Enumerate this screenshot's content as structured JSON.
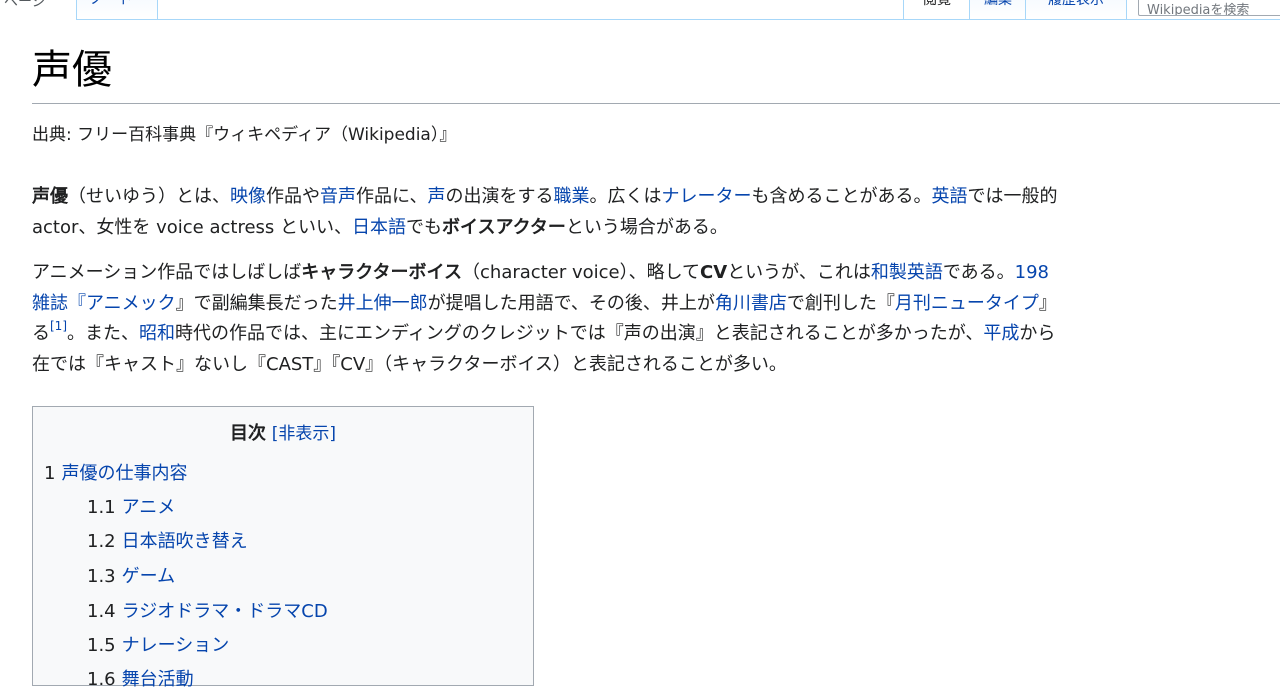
{
  "tabs": {
    "left_cut": "ページ",
    "talk": "ノート",
    "view": "閲覧",
    "edit": "編集",
    "history": "履歴表示",
    "search_placeholder": "Wikipediaを検索"
  },
  "article": {
    "title": "声優",
    "site_sub": "出典: フリー百科事典『ウィキペディア（Wikipedia）』"
  },
  "p1": {
    "s1": "声優",
    "s2": "（せいゆう）とは、",
    "s3": "映像",
    "s4": "作品や",
    "s5": "音声",
    "s6": "作品に、",
    "s7": "声",
    "s8": "の出演をする",
    "s9": "職業",
    "s10": "。広くは",
    "s11": "ナレーター",
    "s12": "も含めることがある。",
    "s13": "英語",
    "s14": "では一般的",
    "s15": "actor、女性を voice actress といい、",
    "s16": "日本語",
    "s17": "でも",
    "s18": "ボイスアクター",
    "s19": "という場合がある。"
  },
  "p2": {
    "a1": "アニメーション作品ではしばしば",
    "a2": "キャラクターボイス",
    "a3": "（character voice）、略して",
    "a4": "CV",
    "a5": "というが、これは",
    "a6": "和製英語",
    "a7": "である。",
    "a8": "198",
    "b1": "雑誌『",
    "b2": "アニメック",
    "b3": "』で副編集長だった",
    "b4": "井上伸一郎",
    "b5": "が提唱した用語で、その後、井上が",
    "b6": "角川書店",
    "b7": "で創刊した『",
    "b8": "月刊ニュータイプ",
    "b9": "』",
    "c1": "る",
    "c2": "[1]",
    "c3": "。また、",
    "c4": "昭和",
    "c5": "時代の作品では、主にエンディングのクレジットでは『声の出演』と表記されることが多かったが、",
    "c6": "平成",
    "c7": "から",
    "d1": "在では『キャスト』ないし『CAST』『CV』（キャラクターボイス）と表記されることが多い。"
  },
  "toc": {
    "title": "目次",
    "toggle": "[非表示]",
    "items": [
      {
        "num": "1",
        "label": "声優の仕事内容"
      },
      {
        "num": "1.1",
        "label": "アニメ"
      },
      {
        "num": "1.2",
        "label": "日本語吹き替え"
      },
      {
        "num": "1.3",
        "label": "ゲーム"
      },
      {
        "num": "1.4",
        "label": "ラジオドラマ・ドラマCD"
      },
      {
        "num": "1.5",
        "label": "ナレーション"
      },
      {
        "num": "1.6",
        "label": "舞台活動"
      }
    ]
  }
}
